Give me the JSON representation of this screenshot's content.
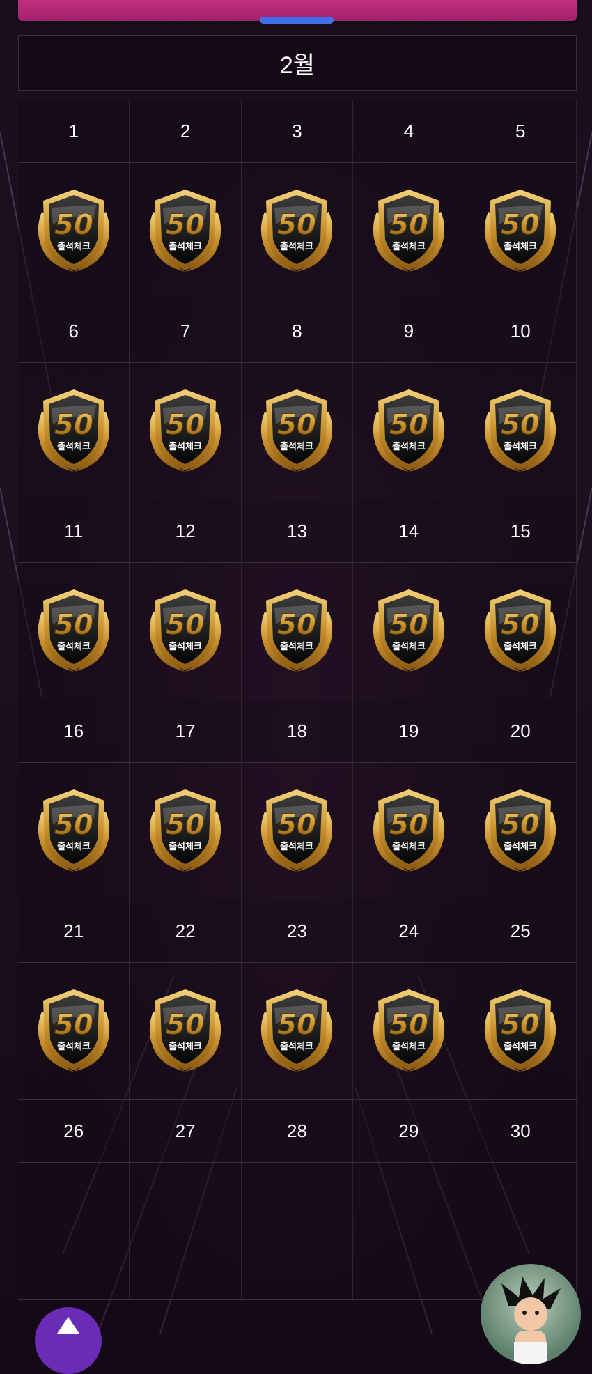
{
  "calendar": {
    "month_label": "2월",
    "badge": {
      "value": "50",
      "label": "출석체크",
      "icon": "attendance-badge-icon",
      "colors": {
        "gold": "#d9a63a",
        "dark": "#111111"
      }
    },
    "weeks": [
      {
        "days": [
          "1",
          "2",
          "3",
          "4",
          "5"
        ],
        "stamped": [
          true,
          true,
          true,
          true,
          true
        ]
      },
      {
        "days": [
          "6",
          "7",
          "8",
          "9",
          "10"
        ],
        "stamped": [
          true,
          true,
          true,
          true,
          true
        ]
      },
      {
        "days": [
          "11",
          "12",
          "13",
          "14",
          "15"
        ],
        "stamped": [
          true,
          true,
          true,
          true,
          true
        ]
      },
      {
        "days": [
          "16",
          "17",
          "18",
          "19",
          "20"
        ],
        "stamped": [
          true,
          true,
          true,
          true,
          true
        ]
      },
      {
        "days": [
          "21",
          "22",
          "23",
          "24",
          "25"
        ],
        "stamped": [
          true,
          true,
          true,
          true,
          true
        ]
      },
      {
        "days": [
          "26",
          "27",
          "28",
          "29",
          "30"
        ],
        "stamped": [
          false,
          false,
          false,
          false,
          false
        ]
      }
    ]
  },
  "controls": {
    "scroll_top_icon": "arrow-up-icon",
    "avatar_icon": "character-avatar"
  },
  "theme": {
    "accent_bar": "#c42f82",
    "handle": "#3f70e8",
    "scroll_button": "#6a2bb5"
  }
}
